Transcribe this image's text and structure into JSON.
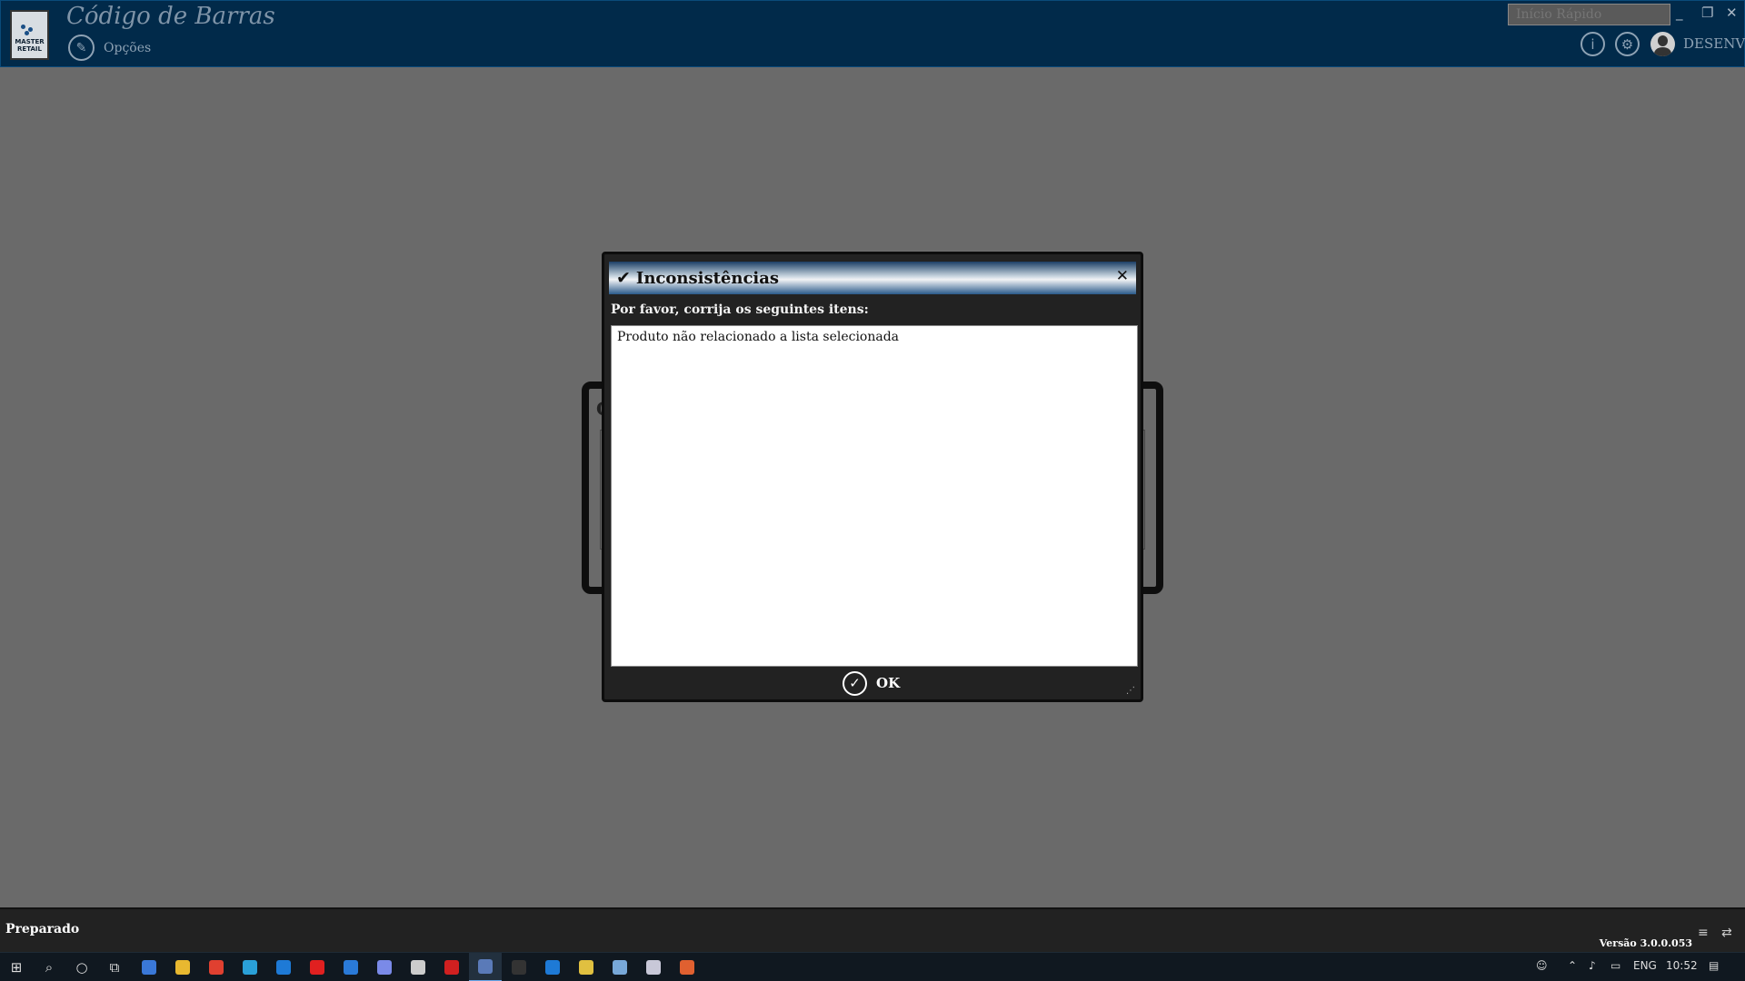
{
  "app": {
    "title": "Código de Barras",
    "logo_text": "MASTER RETAIL",
    "options_label": "Opções",
    "quick_start_placeholder": "Início Rápido",
    "username": "DESENV",
    "minimize_glyph": "_",
    "restore_glyph": "❐",
    "close_glyph": "✕",
    "info_glyph": "i",
    "settings_glyph": "⚙",
    "options_glyph": "✎"
  },
  "modal": {
    "title": "Inconsistências",
    "check_glyph": "✔",
    "close_glyph": "✕",
    "prompt": "Por favor, corrija os seguintes itens:",
    "items": [
      "Produto não relacionado a lista selecionada"
    ],
    "ok_label": "OK",
    "ok_glyph": "✓",
    "resize_glyph": "⋰"
  },
  "background_dialog": {
    "tag": "C"
  },
  "status_bar": {
    "status": "Preparado",
    "version": "Versão 3.0.0.053",
    "db_glyph": "≡",
    "net_glyph": "⇄"
  },
  "taskbar": {
    "start_glyph": "⊞",
    "search_glyph": "⌕",
    "cortana_glyph": "○",
    "taskview_glyph": "⧉",
    "apps": [
      {
        "name": "store",
        "color": "#3a78d8"
      },
      {
        "name": "file-explorer",
        "color": "#e8b830"
      },
      {
        "name": "chrome",
        "color": "#e04030"
      },
      {
        "name": "edge",
        "color": "#2aa0d8"
      },
      {
        "name": "vscode",
        "color": "#1e7ad6"
      },
      {
        "name": "opera",
        "color": "#e02020"
      },
      {
        "name": "mail",
        "color": "#2a7ad8"
      },
      {
        "name": "discord",
        "color": "#7a8ae8"
      },
      {
        "name": "app-generic",
        "color": "#cccccc"
      },
      {
        "name": "app-red",
        "color": "#d02020"
      },
      {
        "name": "master-retail",
        "color": "#5a7ab8"
      },
      {
        "name": "terminal",
        "color": "#333333"
      },
      {
        "name": "vscode-2",
        "color": "#1e7ad6"
      },
      {
        "name": "notepad",
        "color": "#e0c040"
      },
      {
        "name": "app-blue",
        "color": "#78a8d8"
      },
      {
        "name": "app-cloud",
        "color": "#c8c8d8"
      },
      {
        "name": "app-orange",
        "color": "#e06030"
      }
    ],
    "tray_language": "ENG",
    "tray_time": "10:52"
  }
}
